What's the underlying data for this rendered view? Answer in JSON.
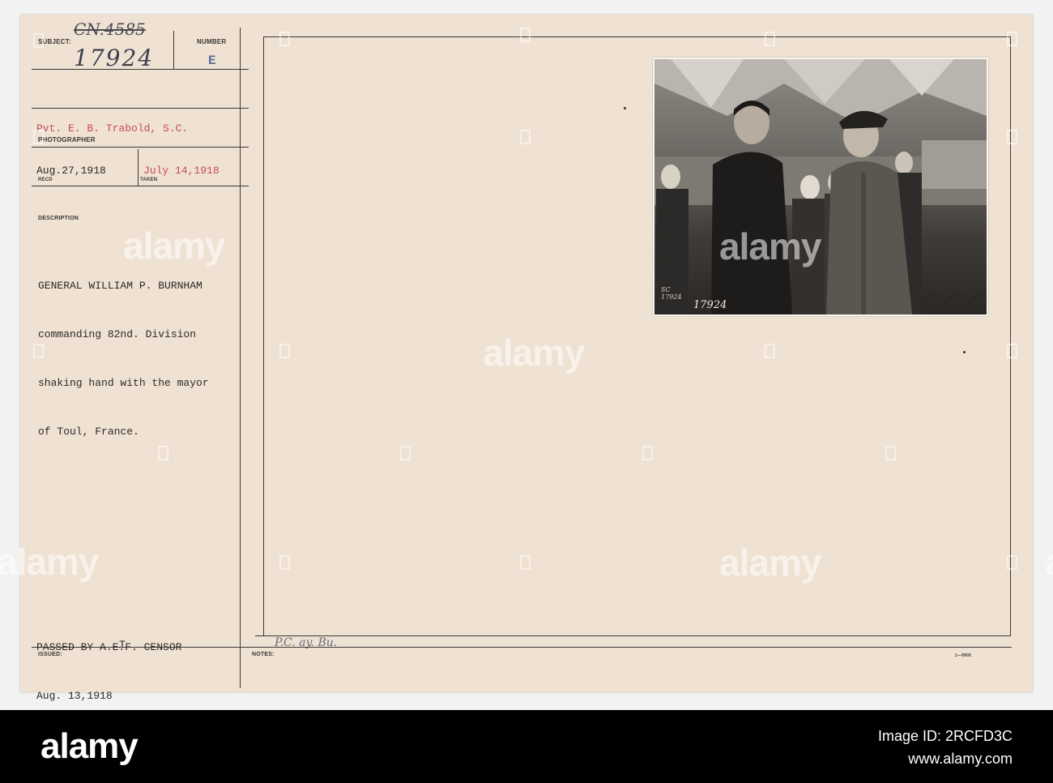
{
  "card": {
    "labels": {
      "subject": "SUBJECT:",
      "number": "NUMBER",
      "photographer": "PHOTOGRAPHER",
      "recd": "RECD",
      "taken": "TAKEN",
      "description": "DESCRIPTION",
      "issued": "ISSUED:",
      "notes": "NOTES:"
    },
    "subject_code_struck": "CN.4585",
    "subject_number": "17924",
    "number_letter": "E",
    "photographer": "Pvt. E. B. Trabold, S.C.",
    "received_date": "Aug.27,1918",
    "taken_date": "July 14,1918",
    "description_lines": [
      "GENERAL WILLIAM P. BURNHAM",
      "commanding 82nd. Division",
      "shaking hand with the mayor",
      "of Toul, France."
    ],
    "censor_lines": [
      "PASSED BY A.E.F. CENSOR",
      "Aug. 13,1918"
    ],
    "issued_mark": "T",
    "notes_handwriting": "P.C. ay. Bu.",
    "form_code": "1—9905"
  },
  "photo": {
    "negative_number": "17924",
    "corner_stamp": "SC 17924"
  },
  "watermark": {
    "brand": "alamy"
  },
  "footer": {
    "brand": "alamy",
    "image_id_label": "Image ID: 2RCFD3C",
    "url": "www.alamy.com"
  }
}
